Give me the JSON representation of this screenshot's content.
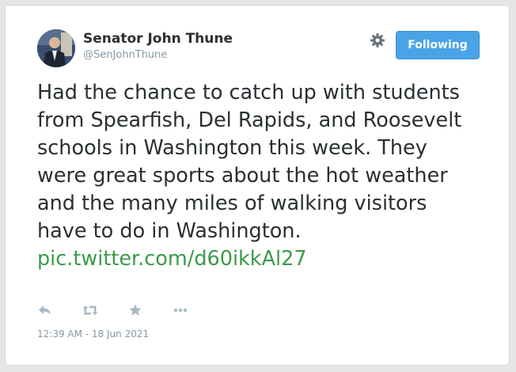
{
  "author": {
    "name": "Senator John Thune",
    "handle": "@SenJohnThune"
  },
  "header": {
    "follow_label": "Following",
    "settings_icon": "gear-icon"
  },
  "tweet": {
    "text": "Had the chance to catch up with students from Spearfish, Del Rapids, and Roosevelt schools in Washington this week. They were great sports about the hot weather and the many miles of walking visitors have to do in Washington.",
    "link": "pic.twitter.com/d60ikkAl27",
    "timestamp": "12:39 AM - 18 Jun 2021"
  },
  "actions": [
    {
      "icon": "reply-icon"
    },
    {
      "icon": "retweet-icon"
    },
    {
      "icon": "favorite-icon"
    },
    {
      "icon": "more-icon"
    }
  ],
  "colors": {
    "link": "#3b9b48",
    "follow_button": "#4aa3e6",
    "text": "#292f33",
    "muted": "#8899a6",
    "action_icons": "#aab8c2"
  }
}
